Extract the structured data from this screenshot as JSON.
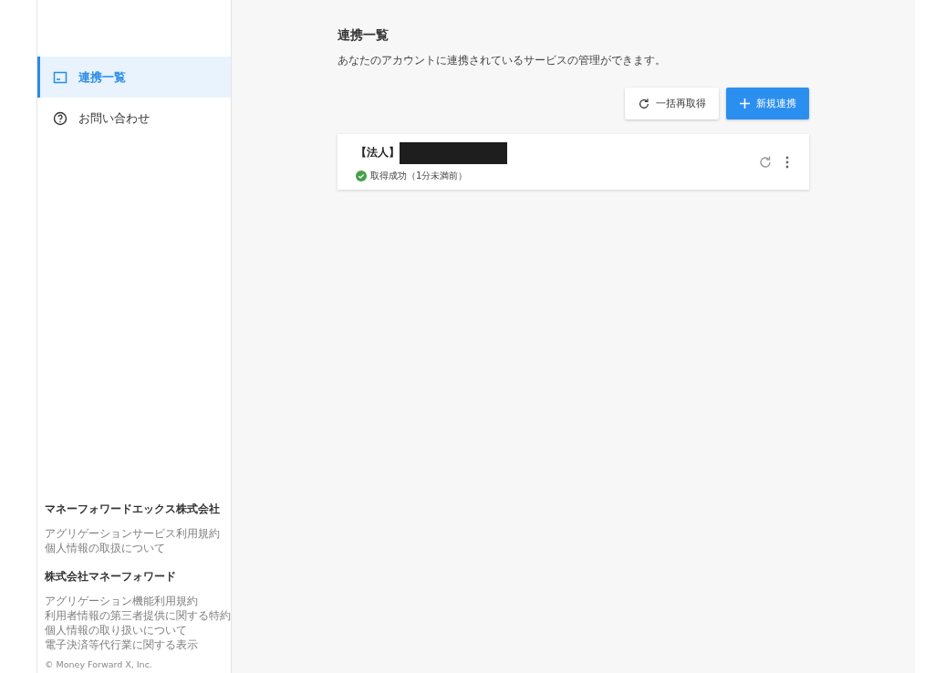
{
  "sidebar": {
    "items": [
      {
        "kind": "card",
        "label": "連携一覧",
        "selected": true
      },
      {
        "kind": "help",
        "label": "お問い合わせ",
        "selected": false
      }
    ],
    "footer": {
      "sections": [
        {
          "company": "マネーフォワードエックス株式会社",
          "links": [
            "アグリゲーションサービス利用規約",
            "個人情報の取扱について"
          ]
        },
        {
          "company": "株式会社マネーフォワード",
          "links": [
            "アグリゲーション機能利用規約",
            "利用者情報の第三者提供に関する特約",
            "個人情報の取り扱いについて",
            "電子決済等代行業に関する表示"
          ]
        }
      ],
      "copyright": "© Money Forward X, Inc."
    }
  },
  "main": {
    "title": "連携一覧",
    "description": "あなたのアカウントに連携されているサービスの管理ができます。",
    "buttons": [
      {
        "kind": "refresh",
        "label": "一括再取得"
      },
      {
        "kind": "add",
        "label": "新規連携"
      }
    ],
    "connections": [
      {
        "name": "【法人】",
        "redacted": true,
        "succeeded": true,
        "status_text": "取得成功（1分未満前）"
      }
    ]
  }
}
